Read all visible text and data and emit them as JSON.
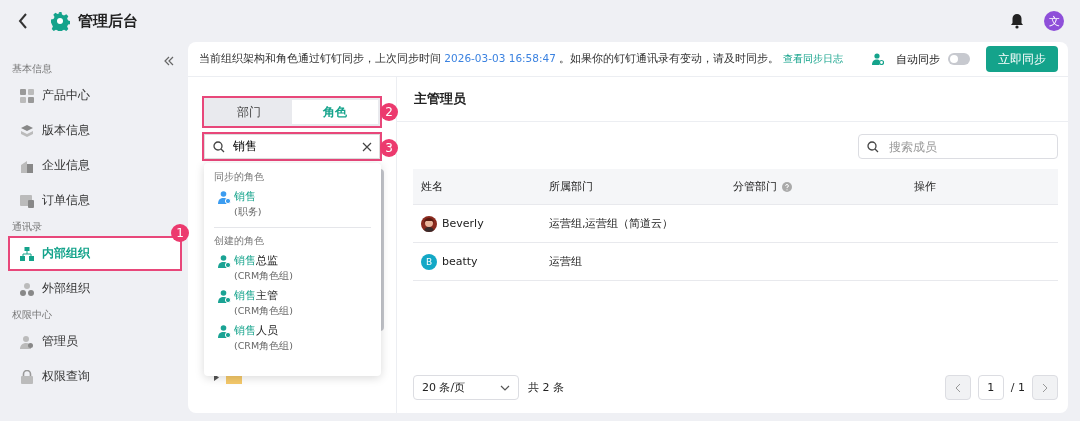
{
  "header": {
    "title": "管理后台",
    "user_initial": "文"
  },
  "sidebar": {
    "sections": [
      {
        "label": "基本信息",
        "items": [
          {
            "label": "产品中心",
            "selected": false
          },
          {
            "label": "版本信息",
            "selected": false
          },
          {
            "label": "企业信息",
            "selected": false
          },
          {
            "label": "订单信息",
            "selected": false
          }
        ]
      },
      {
        "label": "通讯录",
        "items": [
          {
            "label": "内部组织",
            "selected": true,
            "callout": "1"
          },
          {
            "label": "外部组织",
            "selected": false
          }
        ]
      },
      {
        "label": "权限中心",
        "items": [
          {
            "label": "管理员",
            "selected": false
          },
          {
            "label": "权限查询",
            "selected": false
          }
        ]
      }
    ]
  },
  "notice": {
    "text_before": "当前组织架构和角色通过钉钉同步，上次同步时间 ",
    "sync_time": "2026-03-03 16:58:47",
    "text_after": " 。如果你的钉钉通讯录有变动，请及时同步。",
    "log_link": "查看同步日志"
  },
  "auto_sync": {
    "label": "自动同步",
    "on": false
  },
  "sync_button": "立即同步",
  "tabs": {
    "callout": "2",
    "items": [
      {
        "label": "部门",
        "selected": false
      },
      {
        "label": "角色",
        "selected": true
      }
    ]
  },
  "role_search": {
    "value": "销售",
    "callout": "3"
  },
  "role_results": [
    {
      "label": "同步的角色",
      "kind": "synced",
      "items": [
        {
          "match": "销售",
          "note": "(职务)"
        }
      ]
    },
    {
      "label": "创建的角色",
      "kind": "created",
      "items": [
        {
          "match": "销售",
          "rest": "总监",
          "note": "(CRM角色组)"
        },
        {
          "match": "销售",
          "rest": "主管",
          "note": "(CRM角色组)"
        },
        {
          "match": "销售",
          "rest": "人员",
          "note": "(CRM角色组)"
        }
      ]
    }
  ],
  "panel_title": "主管理员",
  "member_search": {
    "placeholder": "搜索成员"
  },
  "table": {
    "columns": [
      {
        "label": "姓名"
      },
      {
        "label": "所属部门"
      },
      {
        "label": "分管部门",
        "help": true
      },
      {
        "label": "操作"
      }
    ],
    "rows": [
      {
        "name": "Beverly",
        "department": "运营组,运营组（简道云）"
      },
      {
        "avatar": {
          "kind": "letter",
          "letter": "B",
          "color": "#13a8c6"
        },
        "name": "beatty",
        "department": "运营组"
      }
    ]
  },
  "pagination": {
    "page_size": "20 条/页",
    "total": "共 2 条",
    "page": "1",
    "pages": "/ 1",
    "prev_disabled": true,
    "next_disabled": true
  }
}
